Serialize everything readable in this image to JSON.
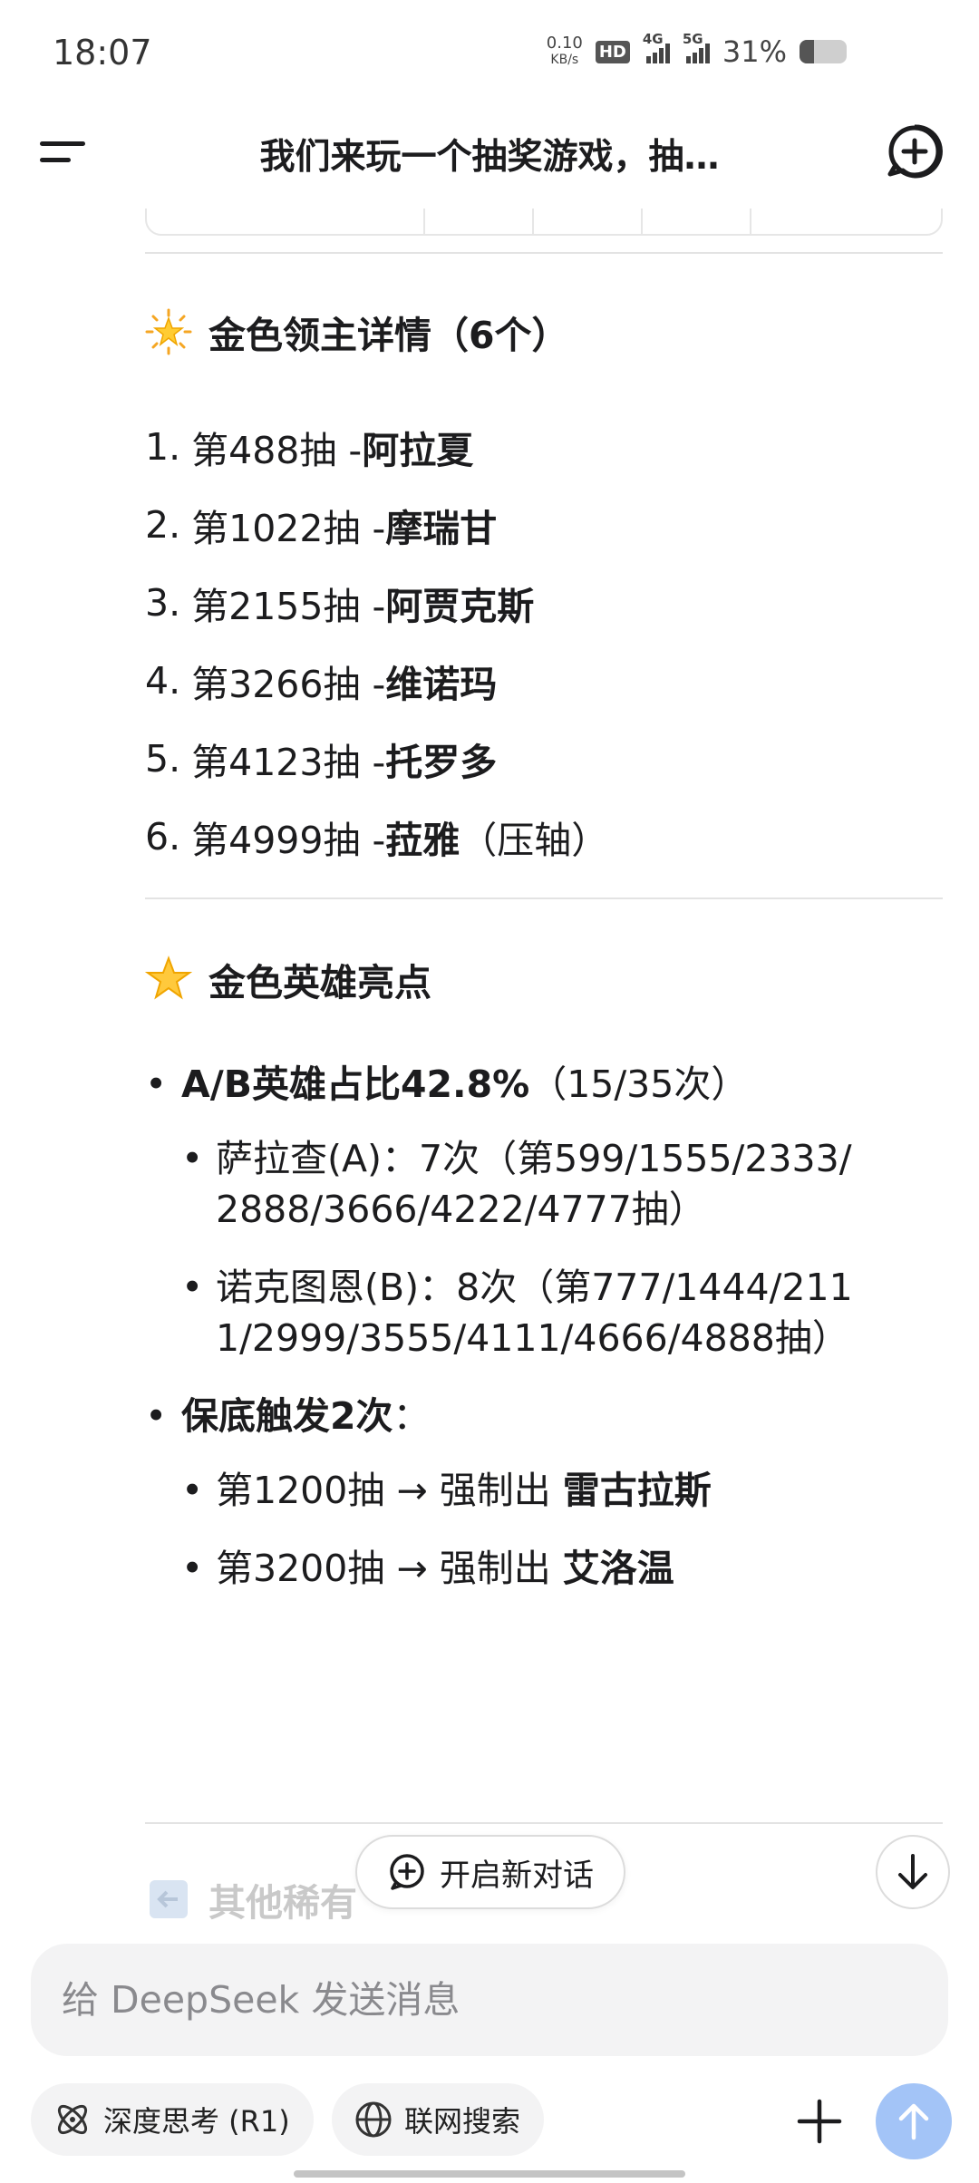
{
  "status_bar": {
    "time": "18:07",
    "net_speed_value": "0.10",
    "net_speed_unit": "KB/s",
    "hd_badge": "HD",
    "network_1": "4G",
    "network_2": "5G",
    "battery": "31%",
    "battery_level": 0.31
  },
  "header": {
    "title": "我们来玩一个抽奖游戏，抽…",
    "menu_icon": "hamburger-menu-icon",
    "new_chat_icon": "new-chat-plus-icon"
  },
  "section_lords": {
    "icon": "glowing-star-emoji",
    "heading": "金色领主详情（6个）",
    "items": [
      {
        "idx": "1.",
        "draw": "第488抽 - ",
        "name": "阿拉夏",
        "note": ""
      },
      {
        "idx": "2.",
        "draw": "第1022抽 - ",
        "name": "摩瑞甘",
        "note": ""
      },
      {
        "idx": "3.",
        "draw": "第2155抽 - ",
        "name": "阿贾克斯",
        "note": ""
      },
      {
        "idx": "4.",
        "draw": "第3266抽 - ",
        "name": "维诺玛",
        "note": ""
      },
      {
        "idx": "5.",
        "draw": "第4123抽 - ",
        "name": "托罗多",
        "note": ""
      },
      {
        "idx": "6.",
        "draw": "第4999抽 - ",
        "name": "菈雅",
        "note": "（压轴）"
      }
    ]
  },
  "section_heroes": {
    "icon": "star-emoji",
    "heading": "金色英雄亮点",
    "bullet1": {
      "bold": "A/B英雄占比42.8%",
      "rest": "（15/35次）",
      "subs": [
        "萨拉查(A)：7次（第599/1555/2333/2888/3666/4222/4777抽）",
        "诺克图恩(B)：8次（第777/1444/2111/2999/3555/4111/4666/4888抽）"
      ]
    },
    "bullet2": {
      "bold": "保底触发2次",
      "rest": "：",
      "subs": [
        {
          "text": "第1200抽 → 强制出 ",
          "name": "雷古拉斯"
        },
        {
          "text": "第3200抽 → 强制出 ",
          "name": "艾洛温"
        }
      ]
    }
  },
  "section_next": {
    "heading": "其他稀有"
  },
  "floating": {
    "new_dialog": "开启新对话"
  },
  "composer": {
    "placeholder": "给 DeepSeek 发送消息",
    "deep_think": "深度思考 (R1)",
    "web_search": "联网搜索",
    "accent": "#4d6bfe",
    "send_color": "#a3c4f7"
  }
}
